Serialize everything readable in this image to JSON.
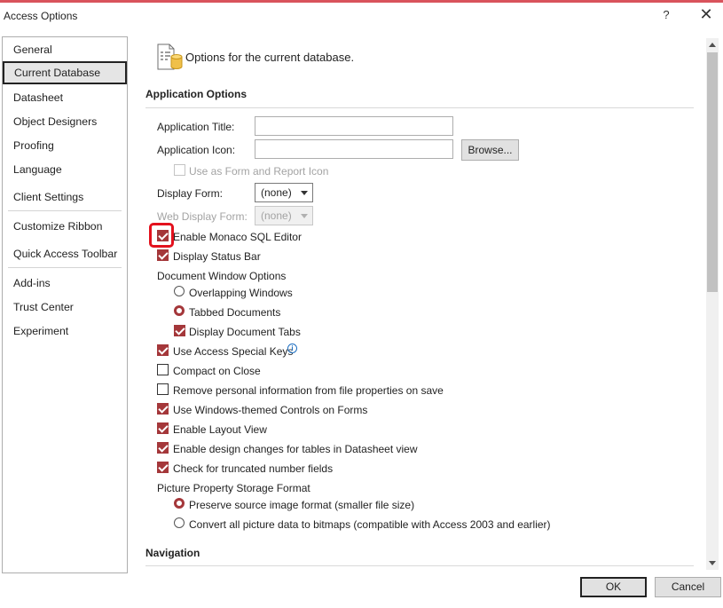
{
  "window": {
    "title": "Access Options",
    "help": "?",
    "close": "✕"
  },
  "sidebar": {
    "items": [
      {
        "label": "General"
      },
      {
        "label": "Current Database"
      },
      {
        "label": "Datasheet"
      },
      {
        "label": "Object Designers"
      },
      {
        "label": "Proofing"
      },
      {
        "label": "Language"
      },
      {
        "label": "Client Settings"
      },
      {
        "label": "Customize Ribbon"
      },
      {
        "label": "Quick Access Toolbar"
      },
      {
        "label": "Add-ins"
      },
      {
        "label": "Trust Center"
      },
      {
        "label": "Experiment"
      }
    ],
    "selected": "Current Database"
  },
  "header": {
    "text": "Options for the current database."
  },
  "application_options": {
    "title": "Application Options",
    "app_title_label": "Application Title:",
    "app_title_value": "",
    "app_icon_label": "Application Icon:",
    "app_icon_value": "",
    "browse_button": "Browse...",
    "use_as_form_icon": {
      "label": "Use as Form and Report Icon",
      "checked": false,
      "disabled": true
    },
    "display_form_label": "Display Form:",
    "display_form_value": "(none)",
    "web_display_form_label": "Web Display Form:",
    "web_display_form_value": "(none)",
    "enable_monaco": {
      "label": "Enable Monaco SQL Editor",
      "checked": true
    },
    "display_status_bar": {
      "label": "Display Status Bar",
      "checked": true
    },
    "document_window_options_label": "Document Window Options",
    "overlapping_windows": {
      "label": "Overlapping Windows",
      "selected": false
    },
    "tabbed_documents": {
      "label": "Tabbed Documents",
      "selected": true
    },
    "display_document_tabs": {
      "label": "Display Document Tabs",
      "checked": true
    },
    "use_access_special_keys": {
      "label": "Use Access Special Keys",
      "checked": true
    },
    "compact_on_close": {
      "label": "Compact on Close",
      "checked": false
    },
    "remove_personal_info": {
      "label": "Remove personal information from file properties on save",
      "checked": false
    },
    "use_windows_themed_controls": {
      "label": "Use Windows-themed Controls on Forms",
      "checked": true
    },
    "enable_layout_view": {
      "label": "Enable Layout View",
      "checked": true
    },
    "enable_design_changes": {
      "label": "Enable design changes for tables in Datasheet view",
      "checked": true
    },
    "check_truncated_numbers": {
      "label": "Check for truncated number fields",
      "checked": true
    },
    "picture_storage_label": "Picture Property Storage Format",
    "preserve_source_format": {
      "label": "Preserve source image format (smaller file size)",
      "selected": true
    },
    "convert_to_bitmaps": {
      "label": "Convert all picture data to bitmaps (compatible with Access 2003 and earlier)",
      "selected": false
    }
  },
  "navigation": {
    "title": "Navigation"
  },
  "footer": {
    "ok": "OK",
    "cancel": "Cancel"
  },
  "colors": {
    "accent": "#a4373a",
    "highlight": "#e3111d"
  }
}
